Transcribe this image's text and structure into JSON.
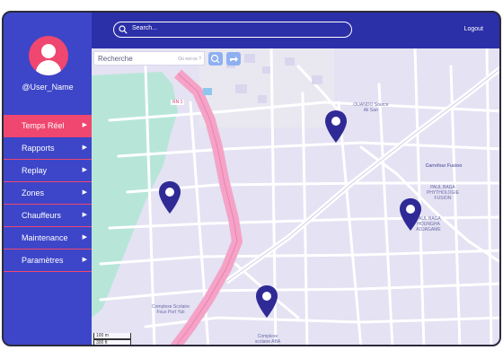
{
  "user": {
    "name": "@User_Name"
  },
  "menu": [
    {
      "label": "Temps Réel",
      "active": true
    },
    {
      "label": "Rapports",
      "active": false
    },
    {
      "label": "Replay",
      "active": false
    },
    {
      "label": "Zones",
      "active": false
    },
    {
      "label": "Chauffeurs",
      "active": false
    },
    {
      "label": "Maintenance",
      "active": false
    },
    {
      "label": "Paramètres",
      "active": false
    }
  ],
  "topbar": {
    "search_placeholder": "Search...",
    "logout_label": "Logout"
  },
  "map": {
    "search_label": "Recherche",
    "search_hint": "Où est-ce ?",
    "road_label": "RN 1",
    "scale_metric": "100 m",
    "scale_imperial": "300 ft",
    "pois": [
      {
        "label": "OUANDO Source Ali Sarr"
      },
      {
        "label": "Carrefour Fusion"
      },
      {
        "label": "PAUL BAGA PHYTHOLOGIE FUSION"
      },
      {
        "label": "PAUL BAGA HOUNGHA ADJAGAME"
      },
      {
        "label": "Complexe Scolaire Foux Port Yuli"
      },
      {
        "label": "Complexe scolaire ABA"
      }
    ],
    "pin_color": "#2f2a95"
  },
  "colors": {
    "sidebar": "#3d46c8",
    "accent": "#ef476f",
    "topbar": "#2b2fa8"
  }
}
